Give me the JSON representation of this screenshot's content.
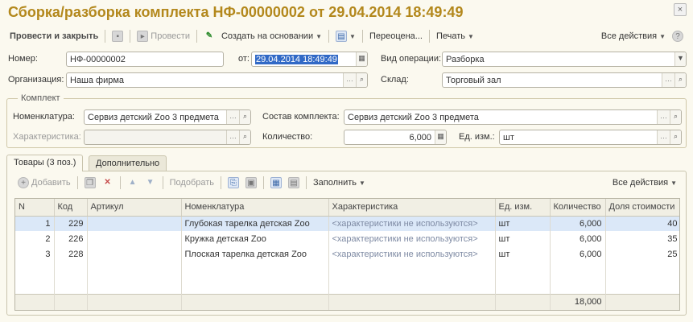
{
  "window": {
    "title": "Сборка/разборка комплекта НФ-00000002 от 29.04.2014 18:49:49",
    "close_label": "×"
  },
  "toolbar": {
    "post_and_close": "Провести и закрыть",
    "post": "Провести",
    "create_based_on": "Создать на основании",
    "rename": "Переоцена...",
    "print": "Печать",
    "all_actions": "Все действия"
  },
  "header": {
    "number_label": "Номер:",
    "number_value": "НФ-00000002",
    "from_label": "от:",
    "date_value": "29.04.2014 18:49:49",
    "operation_label": "Вид операции:",
    "operation_value": "Разборка",
    "org_label": "Организация:",
    "org_value": "Наша фирма",
    "warehouse_label": "Склад:",
    "warehouse_value": "Торговый зал"
  },
  "kit": {
    "group_title": "Комплект",
    "nomenclature_label": "Номенклатура:",
    "nomenclature_value": "Сервиз детский Zoo 3 предмета",
    "composition_label": "Состав комплекта:",
    "composition_value": "Сервиз детский Zoo 3 предмета",
    "characteristic_label": "Характеристика:",
    "characteristic_value": "",
    "quantity_label": "Количество:",
    "quantity_value": "6,000",
    "unit_label": "Ед. изм.:",
    "unit_value": "шт"
  },
  "tabs": [
    {
      "label": "Товары (3 поз.)",
      "active": true
    },
    {
      "label": "Дополнительно",
      "active": false
    }
  ],
  "table_toolbar": {
    "add": "Добавить",
    "pick": "Подобрать",
    "fill": "Заполнить",
    "all_actions": "Все действия"
  },
  "table": {
    "columns": [
      "N",
      "Код",
      "Артикул",
      "Номенклатура",
      "Характеристика",
      "Ед. изм.",
      "Количество",
      "Доля стоимости"
    ],
    "rows": [
      {
        "n": "1",
        "code": "229",
        "article": "",
        "name": "Глубокая тарелка детская Zoo",
        "characteristic": "<характеристики не используются>",
        "unit": "шт",
        "qty": "6,000",
        "share": "40"
      },
      {
        "n": "2",
        "code": "226",
        "article": "",
        "name": "Кружка детская Zoo",
        "characteristic": "<характеристики не используются>",
        "unit": "шт",
        "qty": "6,000",
        "share": "35"
      },
      {
        "n": "3",
        "code": "228",
        "article": "",
        "name": "Плоская тарелка детская Zoo",
        "characteristic": "<характеристики не используются>",
        "unit": "шт",
        "qty": "6,000",
        "share": "25"
      }
    ],
    "total_qty": "18,000"
  },
  "colors": {
    "title": "#b3881c",
    "selection": "#dbe8f8",
    "accent_select": "#3169c6"
  }
}
